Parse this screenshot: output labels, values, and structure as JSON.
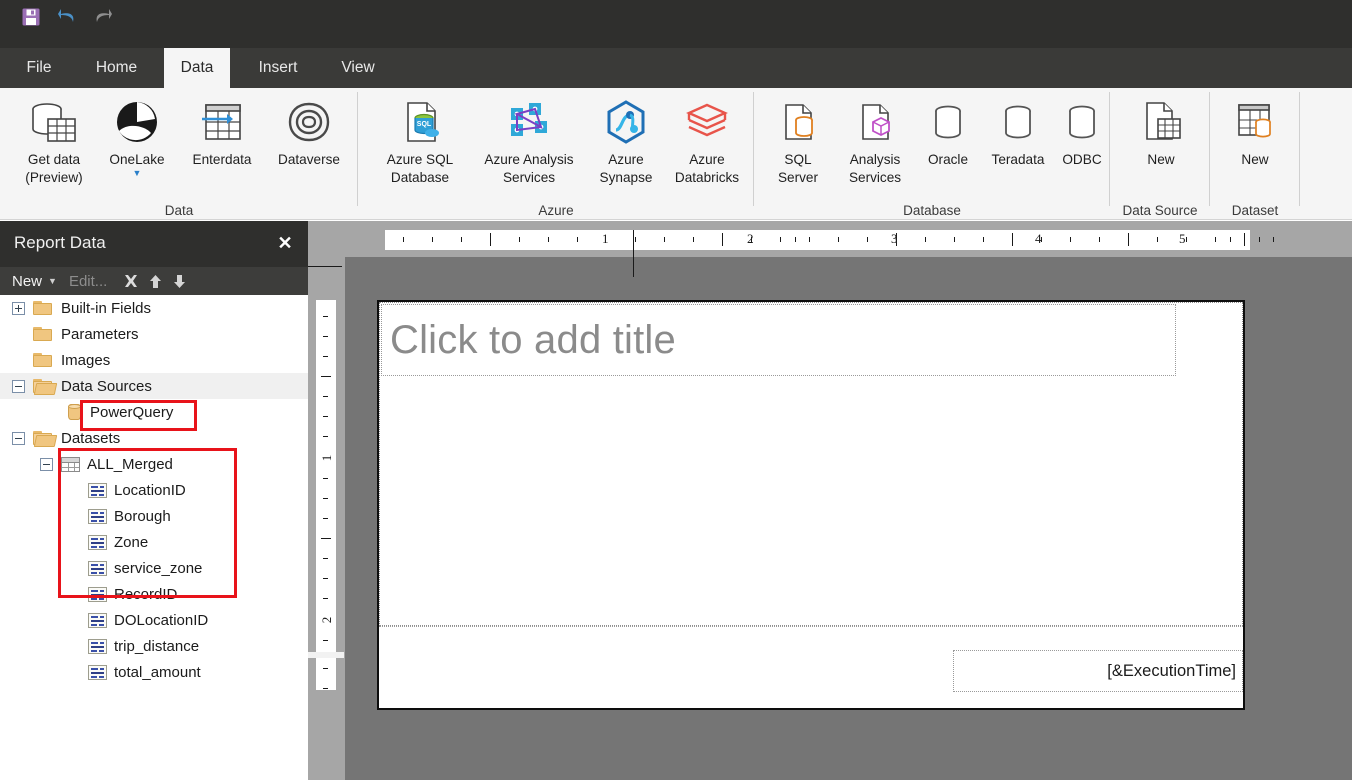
{
  "quick_access": {
    "save_label": "save-icon",
    "undo_label": "undo-icon",
    "redo_label": "redo-icon"
  },
  "tabs": [
    {
      "label": "File",
      "active": false
    },
    {
      "label": "Home",
      "active": false
    },
    {
      "label": "Data",
      "active": true
    },
    {
      "label": "Insert",
      "active": false
    },
    {
      "label": "View",
      "active": false
    }
  ],
  "ribbon": {
    "groups": [
      {
        "name": "Data",
        "label": "Data",
        "buttons": [
          {
            "label1": "Get data",
            "label2": "(Preview)",
            "icon": "get-data-icon",
            "caret": false
          },
          {
            "label1": "OneLake",
            "label2": "",
            "icon": "onelake-icon",
            "caret": true
          },
          {
            "label1": "Enterdata",
            "label2": "",
            "icon": "enter-data-icon",
            "caret": false
          },
          {
            "label1": "Dataverse",
            "label2": "",
            "icon": "dataverse-icon",
            "caret": false
          }
        ]
      },
      {
        "name": "Azure",
        "label": "Azure",
        "buttons": [
          {
            "label1": "Azure SQL",
            "label2": "Database",
            "icon": "azure-sql-database-icon",
            "caret": false
          },
          {
            "label1": "Azure Analysis",
            "label2": "Services",
            "icon": "azure-analysis-services-icon",
            "caret": false
          },
          {
            "label1": "Azure",
            "label2": "Synapse",
            "icon": "azure-synapse-icon",
            "caret": false
          },
          {
            "label1": "Azure",
            "label2": "Databricks",
            "icon": "azure-databricks-icon",
            "caret": false
          }
        ]
      },
      {
        "name": "Database",
        "label": "Database",
        "buttons": [
          {
            "label1": "SQL",
            "label2": "Server",
            "icon": "sql-server-icon",
            "caret": false
          },
          {
            "label1": "Analysis",
            "label2": "Services",
            "icon": "analysis-services-icon",
            "caret": false
          },
          {
            "label1": "Oracle",
            "label2": "",
            "icon": "oracle-icon",
            "caret": false
          },
          {
            "label1": "Teradata",
            "label2": "",
            "icon": "teradata-icon",
            "caret": false
          },
          {
            "label1": "ODBC",
            "label2": "",
            "icon": "odbc-icon",
            "caret": false
          }
        ]
      },
      {
        "name": "Data Source",
        "label": "Data Source",
        "buttons": [
          {
            "label1": "New",
            "label2": "",
            "icon": "new-data-source-icon",
            "caret": false
          }
        ]
      },
      {
        "name": "Dataset",
        "label": "Dataset",
        "buttons": [
          {
            "label1": "New",
            "label2": "",
            "icon": "new-dataset-icon",
            "caret": false
          }
        ]
      }
    ]
  },
  "report_data_panel": {
    "title": "Report Data",
    "close_icon": "close-icon",
    "toolbar": {
      "new_label": "New",
      "new_caret_icon": "chevron-down-icon",
      "edit_label": "Edit...",
      "delete_icon": "delete-x-icon",
      "move_up_icon": "arrow-up-icon",
      "move_down_icon": "arrow-down-icon"
    },
    "tree": [
      {
        "label": "Built-in Fields",
        "type": "folder",
        "expander": "plus",
        "indent": 0
      },
      {
        "label": "Parameters",
        "type": "folder",
        "expander": "none",
        "indent": 0
      },
      {
        "label": "Images",
        "type": "folder",
        "expander": "none",
        "indent": 0
      },
      {
        "label": "Data Sources",
        "type": "folder-open",
        "expander": "minus",
        "indent": 0,
        "selected": true
      },
      {
        "label": "PowerQuery",
        "type": "datasource",
        "expander": "none",
        "indent": 1,
        "highlight": true
      },
      {
        "label": "Datasets",
        "type": "folder-open",
        "expander": "minus",
        "indent": 0
      },
      {
        "label": "ALL_Merged",
        "type": "dataset",
        "expander": "minus",
        "indent": 1,
        "highlight": true
      },
      {
        "label": "LocationID",
        "type": "field",
        "expander": "none",
        "indent": 2
      },
      {
        "label": "Borough",
        "type": "field",
        "expander": "none",
        "indent": 2
      },
      {
        "label": "Zone",
        "type": "field",
        "expander": "none",
        "indent": 2
      },
      {
        "label": "service_zone",
        "type": "field",
        "expander": "none",
        "indent": 2
      },
      {
        "label": "RecordID",
        "type": "field",
        "expander": "none",
        "indent": 2
      },
      {
        "label": "DOLocationID",
        "type": "field",
        "expander": "none",
        "indent": 2
      },
      {
        "label": "trip_distance",
        "type": "field",
        "expander": "none",
        "indent": 2
      },
      {
        "label": "total_amount",
        "type": "field",
        "expander": "none",
        "indent": 2
      }
    ],
    "annotations": {
      "highlight_color": "#e8131a",
      "boxes": [
        "PowerQuery",
        "ALL_Merged dataset and fields"
      ]
    }
  },
  "design_surface": {
    "horizontal_ruler_numbers": [
      "1",
      "2",
      "3",
      "4",
      "5"
    ],
    "vertical_ruler_numbers": [
      "1",
      "2"
    ],
    "title_placeholder": "Click to add title",
    "footer_expression": "[&ExecutionTime]"
  }
}
